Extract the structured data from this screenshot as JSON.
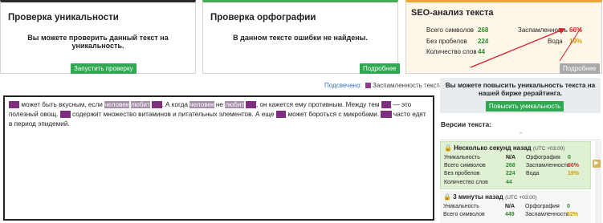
{
  "uniqueness": {
    "title": "Проверка уникальности",
    "message": "Вы можете проверить данный текст на уникальность.",
    "button": "Запустить проверку"
  },
  "spelling": {
    "title": "Проверка орфографии",
    "message": "В данном тексте ошибки не найдены.",
    "button": "Подробнее"
  },
  "seo": {
    "title": "SEO-анализ текста",
    "total_chars_label": "Всего символов",
    "total_chars": "268",
    "no_spaces_label": "Без пробелов",
    "no_spaces": "224",
    "words_label": "Количество слов",
    "words": "44",
    "spam_label": "Заспамленность",
    "spam": "66%",
    "water_label": "Вода",
    "water": "19%",
    "button": "Подробнее"
  },
  "highlight": {
    "label": "Подсвечено:",
    "legend": "Заспамленность текста"
  },
  "editor": {
    "segments": [
      {
        "t": "kw",
        "v": "Лук"
      },
      {
        "t": "n",
        "v": " может быть вкусным, если "
      },
      {
        "t": "wd",
        "v": "человек"
      },
      {
        "t": "n",
        "v": " "
      },
      {
        "t": "wd",
        "v": "любит"
      },
      {
        "t": "n",
        "v": " "
      },
      {
        "t": "kw",
        "v": "лук"
      },
      {
        "t": "n",
        "v": ". А когда "
      },
      {
        "t": "wd",
        "v": "человек"
      },
      {
        "t": "n",
        "v": " не "
      },
      {
        "t": "wd",
        "v": "любит"
      },
      {
        "t": "n",
        "v": " "
      },
      {
        "t": "kw",
        "v": "лук"
      },
      {
        "t": "n",
        "v": ", он кажется ему противным. Между тем "
      },
      {
        "t": "kw",
        "v": "лук"
      },
      {
        "t": "n",
        "v": " — это полезный овощ. "
      },
      {
        "t": "kw",
        "v": "Лук"
      },
      {
        "t": "n",
        "v": " содержит множество витаминов и питательных элементов. А еще "
      },
      {
        "t": "kw",
        "v": "лук"
      },
      {
        "t": "n",
        "v": " может бороться с микробами. "
      },
      {
        "t": "kw",
        "v": "Лук"
      },
      {
        "t": "n",
        "v": " часто едят в период эпидемий."
      }
    ]
  },
  "promo": {
    "text": "Вы можете повысить уникальность текста на нашей бирже рерайтинга.",
    "button": "Повысить уникальность"
  },
  "versions": {
    "title": "Версии текста:",
    "items": [
      {
        "time": "Несколько секунд назад",
        "tz": "(UTC +03:00)",
        "uniq_label": "Уникальность",
        "uniq": "N/A",
        "chars_label": "Всего символов",
        "chars": "268",
        "nospace_label": "Без пробелов",
        "nospace": "224",
        "words_label": "Количество слов",
        "words": "44",
        "spell_label": "Орфография",
        "spell": "0",
        "spam_label": "Заспамленность",
        "spam": "66%",
        "water_label": "Вода",
        "water": "19%"
      },
      {
        "time": "3 минуты назад",
        "tz": "(UTC +03:00)",
        "uniq_label": "Уникальность",
        "uniq": "N/A",
        "chars_label": "Всего символов",
        "chars": "449",
        "spell_label": "Орфография",
        "spell": "0",
        "spam_label": "Заспамленность",
        "spam": "52%"
      }
    ]
  },
  "colors": {
    "accent_green": "#2ea94f",
    "spam_highlight": "#7e307e",
    "warning_red": "#d92b2b"
  }
}
